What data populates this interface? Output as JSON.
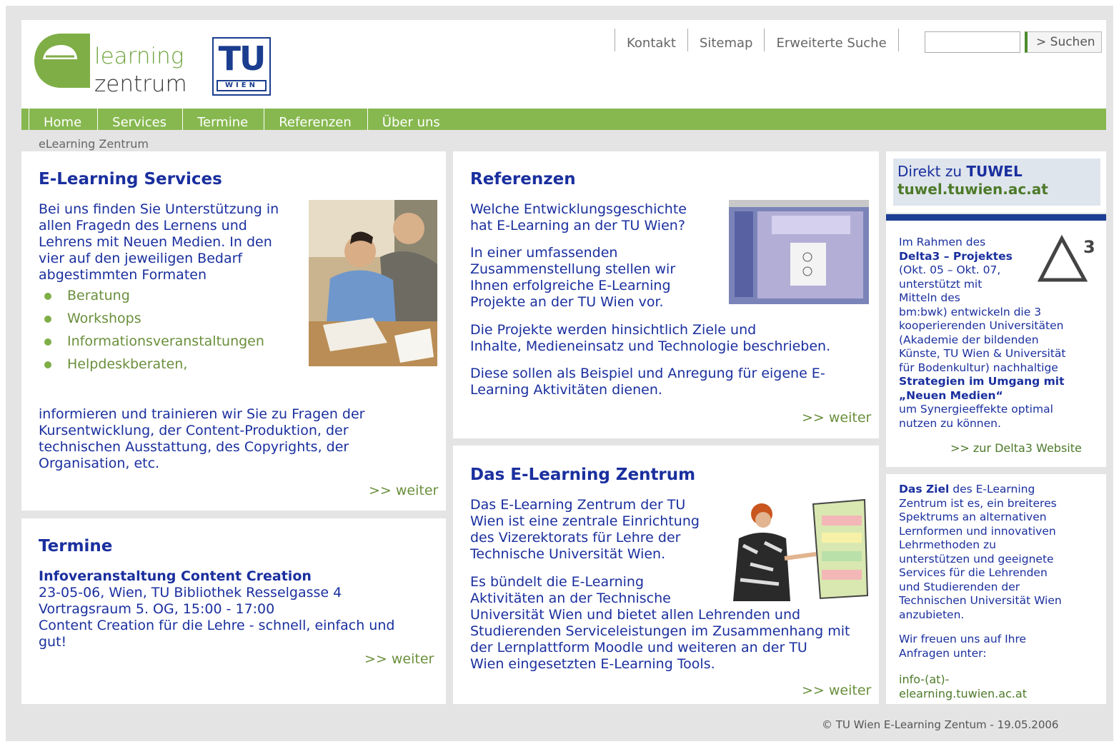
{
  "header": {
    "logo_line1": "learning",
    "logo_line2": "zentrum",
    "tu_logo_text": "TU",
    "tu_logo_sub": "WIEN",
    "toplinks": [
      "Kontakt",
      "Sitemap",
      "Erweiterte Suche"
    ],
    "search_value": "",
    "search_button": "> Suchen"
  },
  "nav": {
    "items": [
      "Home",
      "Services",
      "Termine",
      "Referenzen",
      "Über uns"
    ]
  },
  "breadcrumb": "eLearning Zentrum",
  "services": {
    "title": "E-Learning Services",
    "intro": [
      "Bei uns finden Sie Unterstützung in",
      "allen Fragedn des Lernens und",
      "Lehrens mit Neuen Medien. In den",
      "vier auf den jeweiligen Bedarf",
      "abgestimmten Formaten"
    ],
    "items": [
      "Beratung",
      "Workshops",
      "Informationsveranstaltungen",
      "Helpdeskberaten,"
    ],
    "outro": [
      "informieren und trainieren wir Sie zu Fragen der",
      "Kursentwicklung, der Content-Produktion, der",
      "technischen Ausstattung, des Copyrights, der",
      "Organisation, etc."
    ],
    "more": ">> weiter"
  },
  "termine": {
    "title": "Termine",
    "event_title": "Infoveranstaltung Content Creation",
    "event_lines": [
      "23-05-06, Wien, TU Bibliothek Resselgasse 4",
      "Vortragsraum 5. OG, 15:00 - 17:00",
      "Content Creation für die Lehre - schnell, einfach und",
      "gut!"
    ],
    "more": ">> weiter"
  },
  "referenzen": {
    "title": "Referenzen",
    "p1": [
      "Welche Entwicklungsgeschichte",
      "hat E-Learning an der TU Wien?"
    ],
    "p2": [
      "In einer umfassenden",
      "Zusammenstellung stellen wir",
      "Ihnen erfolgreiche E-Learning",
      "Projekte an der TU Wien vor."
    ],
    "p3": [
      "Die Projekte werden hinsichtlich Ziele und",
      "Inhalte, Medieneinsatz und Technologie beschrieben."
    ],
    "p4": [
      "Diese sollen als Beispiel und Anregung für eigene E-",
      "Learning Aktivitäten dienen."
    ],
    "more": ">> weiter"
  },
  "zentrum": {
    "title": "Das E-Learning Zentrum",
    "p1": [
      "Das E-Learning Zentrum der TU",
      "Wien ist eine zentrale Einrichtung",
      "des Vizerektorats für Lehre der",
      "Technische Universität Wien."
    ],
    "p2": [
      "Es bündelt die E-Learning",
      "Aktivitäten an der Technische",
      "Universität Wien und bietet allen Lehrenden und",
      "Studierenden Serviceleistungen im Zusammenhang mit",
      "der Lernplattform Moodle und weiteren an der TU",
      "Wien eingesetzten E-Learning Tools."
    ],
    "more": ">> weiter"
  },
  "tuwel": {
    "prefix": "Direkt zu ",
    "name": "TUWEL",
    "url": "tuwel.tuwien.ac.at"
  },
  "delta": {
    "logo_sup": "3",
    "l1": "Im Rahmen des",
    "l2": "Delta3 – Projektes",
    "l3": "(Okt. 05 – Okt. 07,",
    "l4": "unterstützt mit",
    "l5": "Mitteln des",
    "l6": "bm:bwk) entwickeln die 3",
    "l7": "kooperierenden Universitäten",
    "l8": "(Akademie der bildenden",
    "l9": "Künste, TU Wien & Universität",
    "l10": "für Bodenkultur) nachhaltige",
    "l11": "Strategien im Umgang mit",
    "l12": "„Neuen Medien“",
    "l13": "um Synergieeffekte optimal",
    "l14": "nutzen zu können.",
    "link": ">> zur Delta3 Website"
  },
  "ziel": {
    "bold": "Das Ziel",
    "l1_rest": " des E-Learning",
    "lines": [
      "Zentrum ist es, ein breiteres",
      "Spektrums an alternativen",
      "Lernformen und innovativen",
      "Lehrmethoden zu",
      "unterstützen und geeignete",
      "Services für die Lehrenden",
      "und Studierenden der",
      "Technischen Universität Wien",
      "anzubieten."
    ],
    "p2": [
      "Wir freuen uns auf Ihre",
      "Anfragen unter:"
    ],
    "email": [
      "info-(at)-",
      "elearning.tuwien.ac.at"
    ]
  },
  "footer": "© TU Wien E-Learning Zentum - 19.05.2006"
}
